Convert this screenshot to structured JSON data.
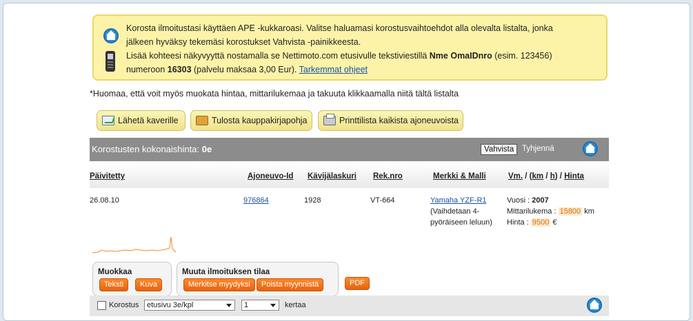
{
  "info": {
    "line1": "Korosta ilmoitustasi käyttäen APE -kukkaroasi. Valitse haluamasi korostusvaihtoehdot alla olevalta listalta, jonka",
    "line2": "jälkeen hyväksy tekemäsi korostukset Vahvista -painikkeesta.",
    "line3_prefix": "Lisää kohteesi näkyvyyttä nostamalla se Nettimoto.com etusivulle tekstiviestillä ",
    "line3_bold": "Nme OmaIDnro",
    "line3_suffix": " (esim. 123456)",
    "line4_prefix": "numeroon ",
    "line4_bold": "16303",
    "line4_suffix": " (palvelu maksaa 3,00 Eur). ",
    "line4_link": "Tarkemmat ohjeet"
  },
  "note": "*Huomaa, että voit myös muokata hintaa, mittarilukemaa ja takuuta klikkaamalla niitä tältä listalta",
  "actions": {
    "send_friend": "Lähetä kaverille",
    "print_contract": "Tulosta kauppakirjapohja",
    "print_list": "Printtilista kaikista ajoneuvoista"
  },
  "summary": {
    "label": "Korostusten kokonaishinta: ",
    "value": "0e",
    "confirm": "Vahvista",
    "clear": "Tyhjennä"
  },
  "table": {
    "headers": {
      "updated": "Päivitetty",
      "vehicle_id": "Ajoneuvo-Id",
      "visits": "Kävijälaskuri",
      "reg_no": "Rek.nro",
      "make_model": "Merkki & Malli",
      "year": "Vm.",
      "km": "km",
      "h": "h",
      "price": "Hinta",
      "sep1": " / (",
      "sep2": " / ",
      "sep3": ") / "
    },
    "row": {
      "updated": "26.08.10",
      "vehicle_id": "976864",
      "visits": "1928",
      "reg_no": "VT-664",
      "model_link": "Yamaha YZF-R1",
      "model_note1": "(Vaihdetaan 4-",
      "model_note2": "pyöräiseen leluun)",
      "year_label": "Vuosi : ",
      "year_value": "2007",
      "mileage_label": "Mittarilukema : ",
      "mileage_value": "15800",
      "mileage_unit": " km",
      "price_label": "Hinta : ",
      "price_value": "9500",
      "price_unit": " €"
    }
  },
  "edit": {
    "muokkaa": "Muokkaa",
    "text_btn": "Teksti",
    "image_btn": "Kuva",
    "status_title": "Muuta ilmoituksen tilaa",
    "mark_sold": "Merkitse myydyksi",
    "remove_sale": "Poista myynnistä",
    "pdf": "PDF"
  },
  "footer": {
    "korostus": "Korostus",
    "placement_select": "etusivu 3e/kpl",
    "count_select": "1",
    "times": "kertaa"
  },
  "colors": {
    "info_bg": "#fcf3a8",
    "action_bg": "#efe38a",
    "bar_bg": "#8c8c8c",
    "orange_button": "#f07818",
    "link": "#1a53a3",
    "sparkline": "#f08a20"
  }
}
